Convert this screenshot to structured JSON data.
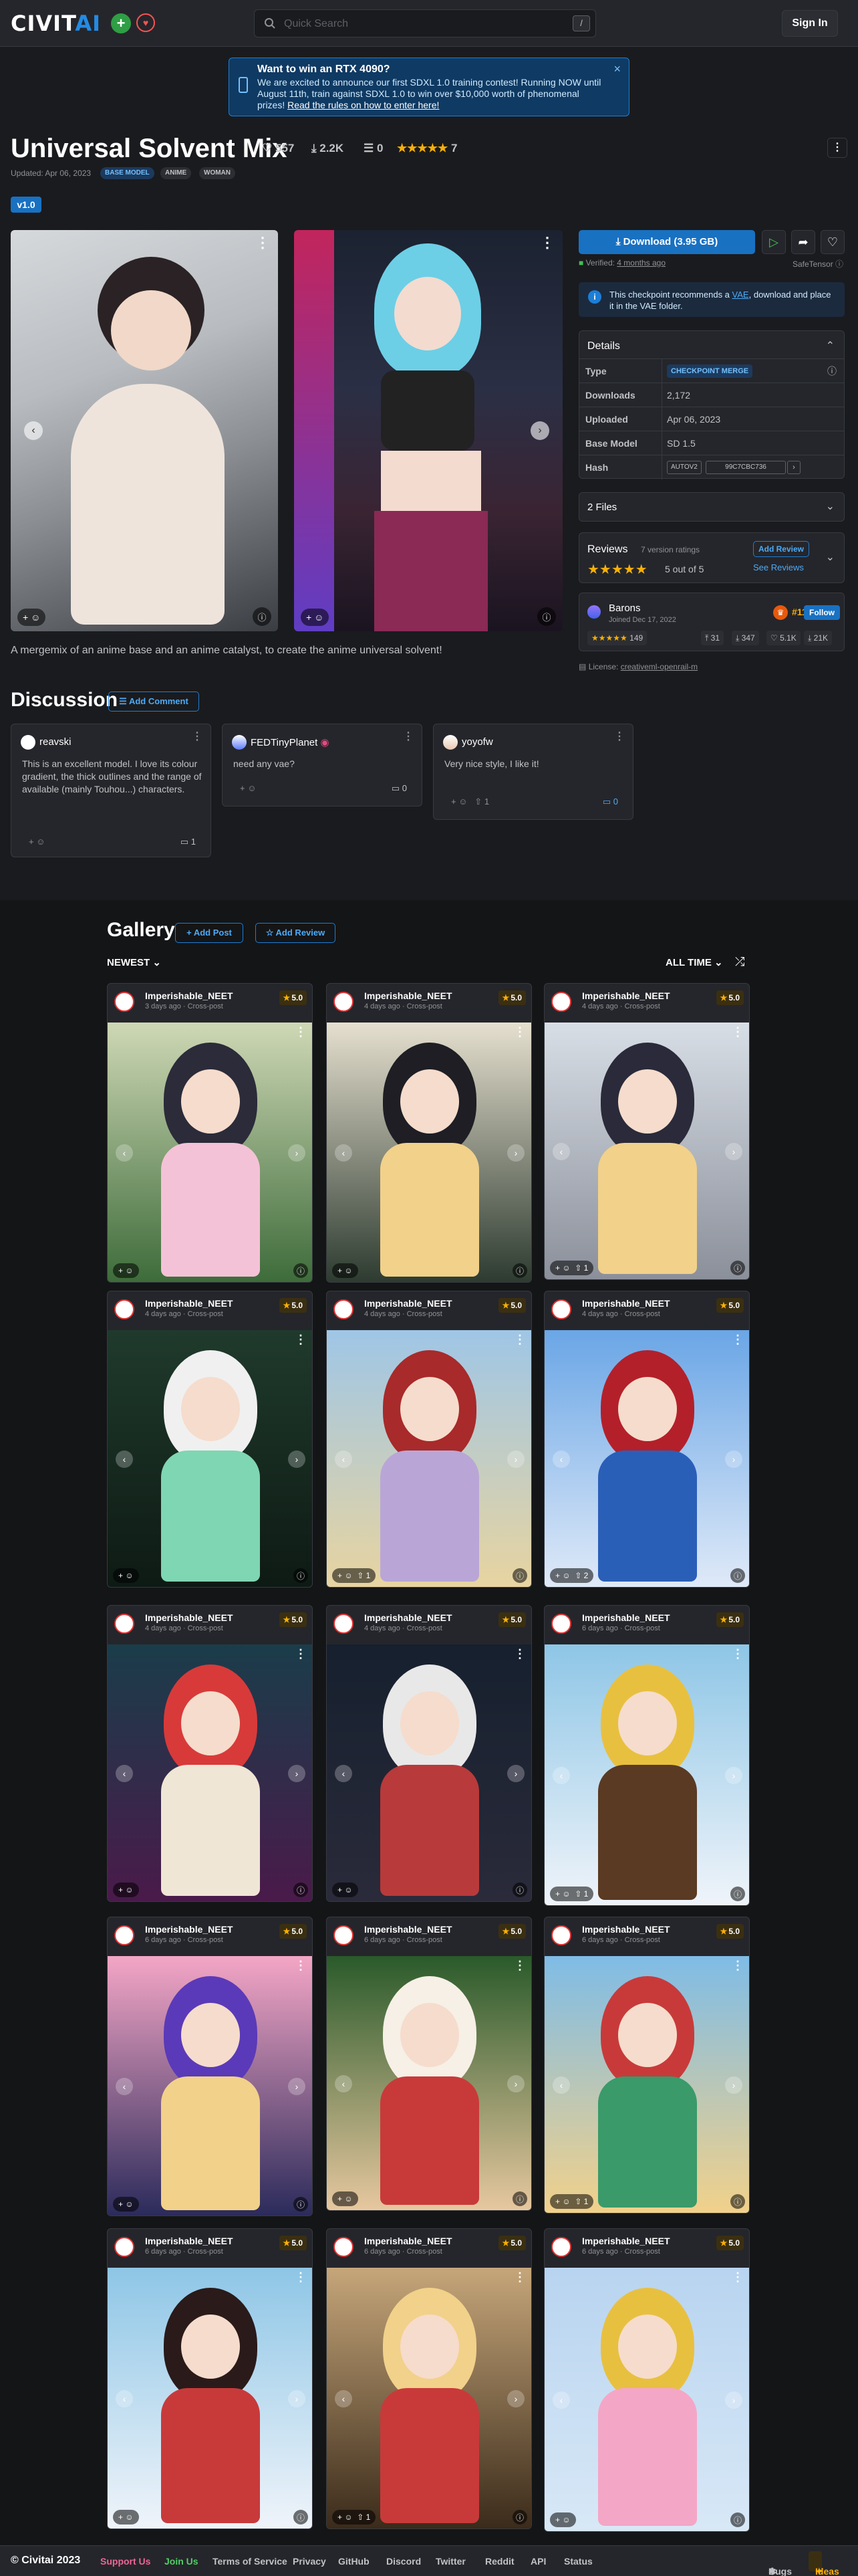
{
  "header": {
    "logo_main": "CIVIT",
    "logo_accent": "AI",
    "search_placeholder": "Quick Search",
    "search_shortcut": "/",
    "sign_in": "Sign In"
  },
  "announcement": {
    "title": "Want to win an RTX 4090?",
    "body": "We are excited to announce our first SDXL 1.0 training contest! Running NOW until August 11th, train against SDXL 1.0 to win over $10,000 worth of phenomenal prizes!",
    "link": "Read the rules on how to enter here!"
  },
  "model": {
    "title": "Universal Solvent Mix",
    "likes": "557",
    "downloads": "2.2K",
    "comments": "0",
    "rating_count": "7",
    "updated": "Updated: Apr 06, 2023",
    "tags": [
      "BASE MODEL",
      "ANIME",
      "WOMAN"
    ],
    "version": "v1.0",
    "description": "A mergemix of an anime base and an anime catalyst, to create the anime universal solvent!",
    "stars": "★★★★★"
  },
  "download": {
    "label": "Download (3.95 GB)",
    "verified_prefix": "Verified:",
    "verified_time": "4 months ago",
    "safetensor": "SafeTensor",
    "vae_notice_a": "This checkpoint recommends a",
    "vae_link": "VAE",
    "vae_notice_b": ", download and place it in the VAE folder."
  },
  "details": {
    "heading": "Details",
    "rows": [
      {
        "k": "Type",
        "v": "CHECKPOINT MERGE"
      },
      {
        "k": "Downloads",
        "v": "2,172"
      },
      {
        "k": "Uploaded",
        "v": "Apr 06, 2023"
      },
      {
        "k": "Base Model",
        "v": "SD 1.5"
      },
      {
        "k": "Hash",
        "v": "AUTOV2",
        "hash": "99C7CBC736"
      }
    ]
  },
  "files": {
    "label": "2 Files"
  },
  "reviews": {
    "heading": "Reviews",
    "subtitle": "7 version ratings",
    "add": "Add Review",
    "see": "See Reviews",
    "stars": "★★★★★",
    "score": "5 out of 5"
  },
  "creator": {
    "name": "Barons",
    "joined": "Joined Dec 17, 2022",
    "rank": "#11",
    "follow": "Follow",
    "stars": "★★★★★",
    "count": "149",
    "uploads": "31",
    "downloads": "347",
    "likes": "5.1K",
    "views": "21K",
    "license_label": "License:",
    "license": "creativeml-openrail-m"
  },
  "discussion": {
    "heading": "Discussion",
    "add": "Add Comment",
    "comments": [
      {
        "user": "reavski",
        "text": "This is an excellent model. I love its colour gradient, the thick outlines and the range of available (mainly Touhou...) characters.",
        "count": "1"
      },
      {
        "user": "FEDTinyPlanet",
        "text": "need any vae?",
        "count": "0"
      },
      {
        "user": "yoyofw",
        "text": "Very nice style, I like it!",
        "count": "0",
        "react": "1"
      }
    ]
  },
  "gallery": {
    "heading": "Gallery",
    "add_post": "Add Post",
    "add_review": "Add Review",
    "sort": "NEWEST",
    "period": "ALL TIME",
    "cards": [
      {
        "user": "Imperishable_NEET",
        "time": "3 days ago · Cross-post",
        "rating": "5.0",
        "count": ""
      },
      {
        "user": "Imperishable_NEET",
        "time": "4 days ago · Cross-post",
        "rating": "5.0",
        "count": ""
      },
      {
        "user": "Imperishable_NEET",
        "time": "4 days ago · Cross-post",
        "rating": "5.0",
        "count": "1"
      },
      {
        "user": "Imperishable_NEET",
        "time": "4 days ago · Cross-post",
        "rating": "5.0",
        "count": ""
      },
      {
        "user": "Imperishable_NEET",
        "time": "4 days ago · Cross-post",
        "rating": "5.0",
        "count": "1"
      },
      {
        "user": "Imperishable_NEET",
        "time": "4 days ago · Cross-post",
        "rating": "5.0",
        "count": "2"
      },
      {
        "user": "Imperishable_NEET",
        "time": "4 days ago · Cross-post",
        "rating": "5.0",
        "count": ""
      },
      {
        "user": "Imperishable_NEET",
        "time": "4 days ago · Cross-post",
        "rating": "5.0",
        "count": ""
      },
      {
        "user": "Imperishable_NEET",
        "time": "6 days ago · Cross-post",
        "rating": "5.0",
        "count": "1"
      },
      {
        "user": "Imperishable_NEET",
        "time": "6 days ago · Cross-post",
        "rating": "5.0",
        "count": ""
      },
      {
        "user": "Imperishable_NEET",
        "time": "6 days ago · Cross-post",
        "rating": "5.0",
        "count": ""
      },
      {
        "user": "Imperishable_NEET",
        "time": "6 days ago · Cross-post",
        "rating": "5.0",
        "count": "1"
      },
      {
        "user": "Imperishable_NEET",
        "time": "6 days ago · Cross-post",
        "rating": "5.0",
        "count": ""
      },
      {
        "user": "Imperishable_NEET",
        "time": "6 days ago · Cross-post",
        "rating": "5.0",
        "count": "1"
      },
      {
        "user": "Imperishable_NEET",
        "time": "6 days ago · Cross-post",
        "rating": "5.0",
        "count": ""
      }
    ]
  },
  "footer": {
    "copyright": "© Civitai 2023",
    "links": [
      "Support Us",
      "Join Us",
      "Terms of Service",
      "Privacy",
      "GitHub",
      "Discord",
      "Twitter",
      "Reddit",
      "API",
      "Status"
    ],
    "bugs": "Bugs",
    "ideas": "Ideas"
  },
  "colors": {
    "accent": "#228be6",
    "background": "#1a1b1e",
    "panel": "#25262b",
    "star": "#fab005"
  }
}
